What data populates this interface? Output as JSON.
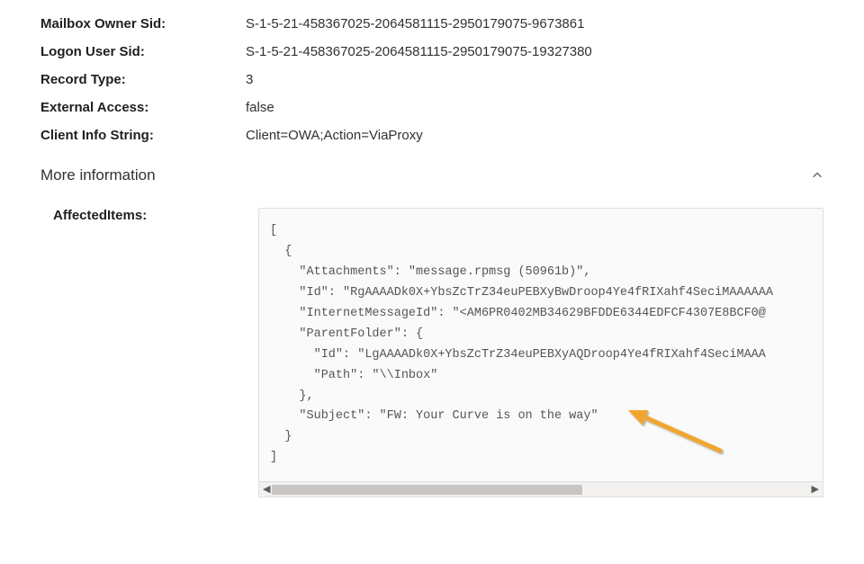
{
  "fields": [
    {
      "label": "Mailbox Owner Sid:",
      "value": "S-1-5-21-458367025-2064581115-2950179075-9673861"
    },
    {
      "label": "Logon User Sid:",
      "value": "S-1-5-21-458367025-2064581115-2950179075-19327380"
    },
    {
      "label": "Record Type:",
      "value": "3"
    },
    {
      "label": "External Access:",
      "value": "false"
    },
    {
      "label": "Client Info String:",
      "value": "Client=OWA;Action=ViaProxy"
    }
  ],
  "section": {
    "title": "More information"
  },
  "affected": {
    "label": "AffectedItems:",
    "code": "[\n  {\n    \"Attachments\": \"message.rpmsg (50961b)\",\n    \"Id\": \"RgAAAADk0X+YbsZcTrZ34euPEBXyBwDroop4Ye4fRIXahf4SeciMAAAAAA\n    \"InternetMessageId\": \"<AM6PR0402MB34629BFDDE6344EDFCF4307E8BCF0@\n    \"ParentFolder\": {\n      \"Id\": \"LgAAAADk0X+YbsZcTrZ34euPEBXyAQDroop4Ye4fRIXahf4SeciMAAA\n      \"Path\": \"\\\\Inbox\"\n    },\n    \"Subject\": \"FW: Your Curve is on the way\"\n  }\n]"
  },
  "colors": {
    "arrow": "#f0a62e"
  }
}
